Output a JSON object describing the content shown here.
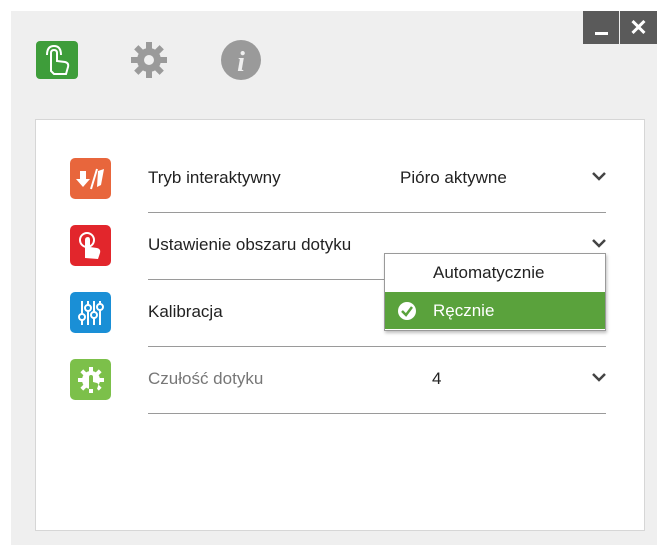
{
  "window": {
    "minimize_label": "_",
    "close_label": "✕"
  },
  "toolbar": {
    "icons": [
      "touch-hand-icon",
      "gear-icon",
      "info-icon"
    ],
    "active_color": "#3e9d3a",
    "inactive_color": "#9a9a9a"
  },
  "settings": {
    "rows": [
      {
        "label": "Tryb interaktywny",
        "value": "Pióro aktywne",
        "icon": "interactive-mode-icon",
        "icon_color": "#e8663c"
      },
      {
        "label": "Ustawienie obszaru dotyku",
        "value": "",
        "icon": "touch-area-icon",
        "icon_color": "#e2262c"
      },
      {
        "label": "Kalibracja",
        "value": "",
        "icon": "sliders-icon",
        "icon_color": "#1a8fd6"
      },
      {
        "label": "Czułość dotyku",
        "value": "4",
        "icon": "gear-hand-icon",
        "icon_color": "#7cc04a"
      }
    ]
  },
  "dropdown": {
    "options": [
      "Automatycznie",
      "Ręcznie"
    ],
    "selected": "Ręcznie",
    "selected_color": "#5aa23c"
  }
}
